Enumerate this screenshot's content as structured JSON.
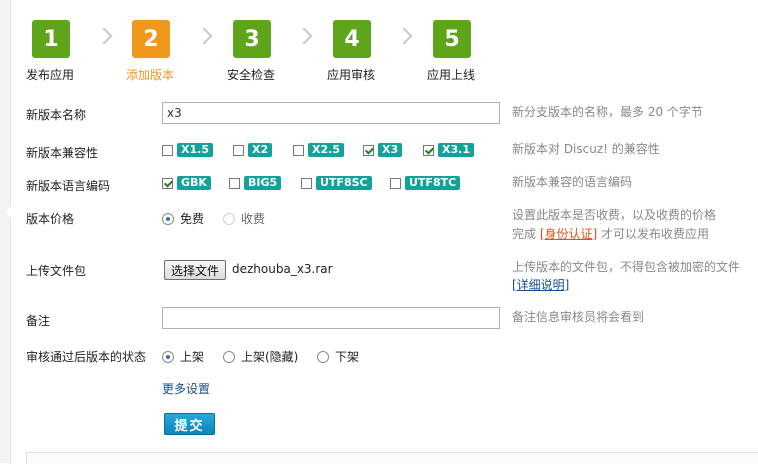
{
  "steps": [
    {
      "num": "1",
      "label": "发布应用",
      "state": "done"
    },
    {
      "num": "2",
      "label": "添加版本",
      "state": "current"
    },
    {
      "num": "3",
      "label": "安全检查",
      "state": "done"
    },
    {
      "num": "4",
      "label": "应用审核",
      "state": "done"
    },
    {
      "num": "5",
      "label": "应用上线",
      "state": "done"
    }
  ],
  "version_name": {
    "label": "新版本名称",
    "value": "x3",
    "hint": "新分支版本的名称，最多 20 个字节"
  },
  "compat": {
    "label": "新版本兼容性",
    "options": [
      {
        "text": "X1.5",
        "checked": false
      },
      {
        "text": "X2",
        "checked": false
      },
      {
        "text": "X2.5",
        "checked": false
      },
      {
        "text": "X3",
        "checked": true
      },
      {
        "text": "X3.1",
        "checked": true
      }
    ],
    "hint": "新版本对 Discuz! 的兼容性"
  },
  "encoding": {
    "label": "新版本语言编码",
    "options": [
      {
        "text": "GBK",
        "checked": true
      },
      {
        "text": "BIG5",
        "checked": false
      },
      {
        "text": "UTF8SC",
        "checked": false
      },
      {
        "text": "UTF8TC",
        "checked": false
      }
    ],
    "hint": "新版本兼容的语言编码"
  },
  "price": {
    "label": "版本价格",
    "options": [
      {
        "text": "免费",
        "selected": true
      },
      {
        "text": "收费",
        "selected": false
      }
    ],
    "hint_line1": "设置此版本是否收费，以及收费的价格",
    "hint_prefix": "完成",
    "hint_link": "[身份认证]",
    "hint_suffix": "才可以发布收费应用"
  },
  "upload": {
    "label": "上传文件包",
    "button": "选择文件",
    "filename": "dezhouba_x3.rar",
    "hint": "上传版本的文件包，不得包含被加密的文件",
    "hint_link": "[详细说明]"
  },
  "remark": {
    "label": "备注",
    "value": "",
    "hint": "备注信息审核员将会看到"
  },
  "status": {
    "label": "审核通过后版本的状态",
    "options": [
      {
        "text": "上架",
        "selected": true
      },
      {
        "text": "上架(隐藏)",
        "selected": false
      },
      {
        "text": "下架",
        "selected": false
      }
    ]
  },
  "more_settings": "更多设置",
  "submit": "提交",
  "colors": {
    "step_done": "#5fa51b",
    "step_current": "#f0981c",
    "tag": "#12a29b",
    "submit": "#0b86bf"
  }
}
